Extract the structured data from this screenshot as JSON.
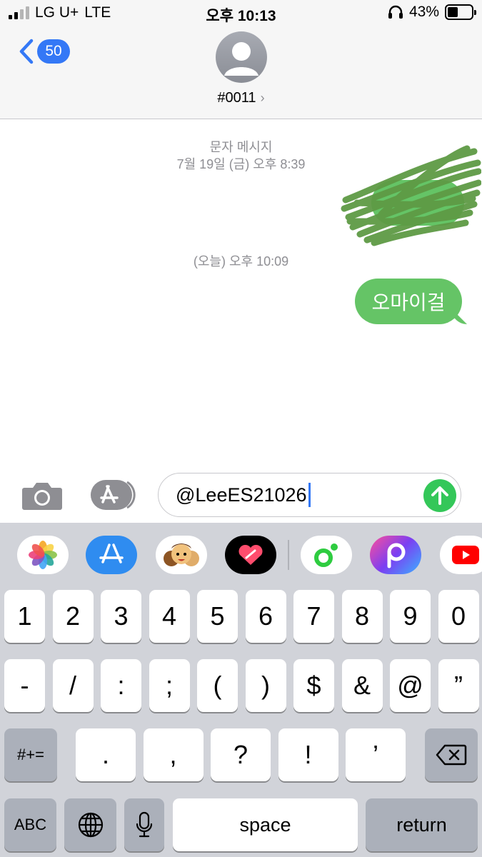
{
  "status_bar": {
    "carrier": "LG U+",
    "network": "LTE",
    "time": "오후 10:13",
    "battery": "43%",
    "battery_level": 0.43
  },
  "nav": {
    "back_count": "50",
    "contact_name": "#0011",
    "chevron": "›"
  },
  "messages": {
    "service_label": "문자 메시지",
    "date1": "7월 19일 (금) 오후 8:39",
    "date2": "(오늘) 오후 10:09",
    "bubble_text": "오마이걸"
  },
  "input": {
    "value": "@LeeES21026"
  },
  "app_drawer": {
    "icons": [
      "photos-icon",
      "app-store-icon",
      "memoji-icon",
      "digital-touch-icon",
      "music-app-icon",
      "picsart-icon",
      "youtube-icon"
    ]
  },
  "keyboard": {
    "row1": [
      "1",
      "2",
      "3",
      "4",
      "5",
      "6",
      "7",
      "8",
      "9",
      "0"
    ],
    "row2": [
      "-",
      "/",
      ":",
      ";",
      "(",
      ")",
      "$",
      "&",
      "@",
      "”"
    ],
    "row3_left": "#+=",
    "row3": [
      ".",
      ",",
      "?",
      "!",
      "’"
    ],
    "abc": "ABC",
    "space": "space",
    "return": "return"
  },
  "colors": {
    "accent_blue": "#3478f6",
    "bubble_green": "#65c466",
    "send_green": "#34c759"
  }
}
